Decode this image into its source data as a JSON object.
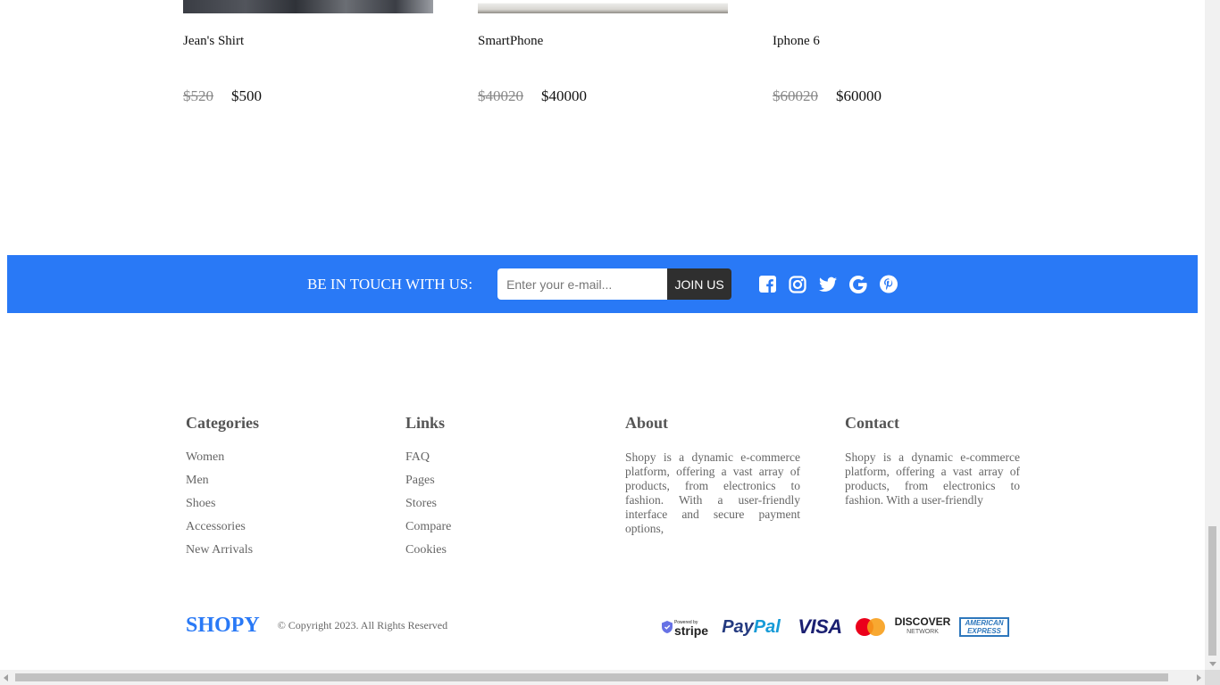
{
  "products": [
    {
      "name": "Jean's Shirt",
      "old_price": "$520",
      "price": "$500",
      "image": "shirt-photo"
    },
    {
      "name": "SmartPhone",
      "old_price": "$40020",
      "price": "$40000",
      "image": "smartphone-photo"
    },
    {
      "name": "Iphone 6",
      "old_price": "$60020",
      "price": "$60000",
      "image": "iphone-photo"
    }
  ],
  "newsletter": {
    "label": "BE IN TOUCH WITH US:",
    "placeholder": "Enter your e-mail...",
    "button": "JOIN US",
    "socials": [
      "facebook-icon",
      "instagram-icon",
      "twitter-icon",
      "google-icon",
      "pinterest-icon"
    ]
  },
  "footer": {
    "categories": {
      "title": "Categories",
      "items": [
        "Women",
        "Men",
        "Shoes",
        "Accessories",
        "New Arrivals"
      ]
    },
    "links": {
      "title": "Links",
      "items": [
        "FAQ",
        "Pages",
        "Stores",
        "Compare",
        "Cookies"
      ]
    },
    "about": {
      "title": "About",
      "text": "Shopy is a dynamic e-commerce platform, offering a vast array of products, from electronics to fashion. With a user-friendly interface and secure payment options,"
    },
    "contact": {
      "title": "Contact",
      "text": "Shopy is a dynamic e-commerce platform, offering a vast array of products, from electronics to fashion. With a user-friendly"
    }
  },
  "bottom": {
    "brand": "SHOPY",
    "copyright": "© Copyright 2023. All Rights Reserved",
    "payments": {
      "stripe": "stripe",
      "stripe_small": "Powered by",
      "paypal_a": "Pay",
      "paypal_b": "Pal",
      "visa": "VISA",
      "mastercard": "MasterCard",
      "discover": "DISCOVER",
      "discover_small": "NETWORK",
      "amex_a": "AMERICAN",
      "amex_b": "EXPRESS"
    }
  },
  "colors": {
    "accent": "#2979f6",
    "join_button": "#2f2f2f"
  }
}
